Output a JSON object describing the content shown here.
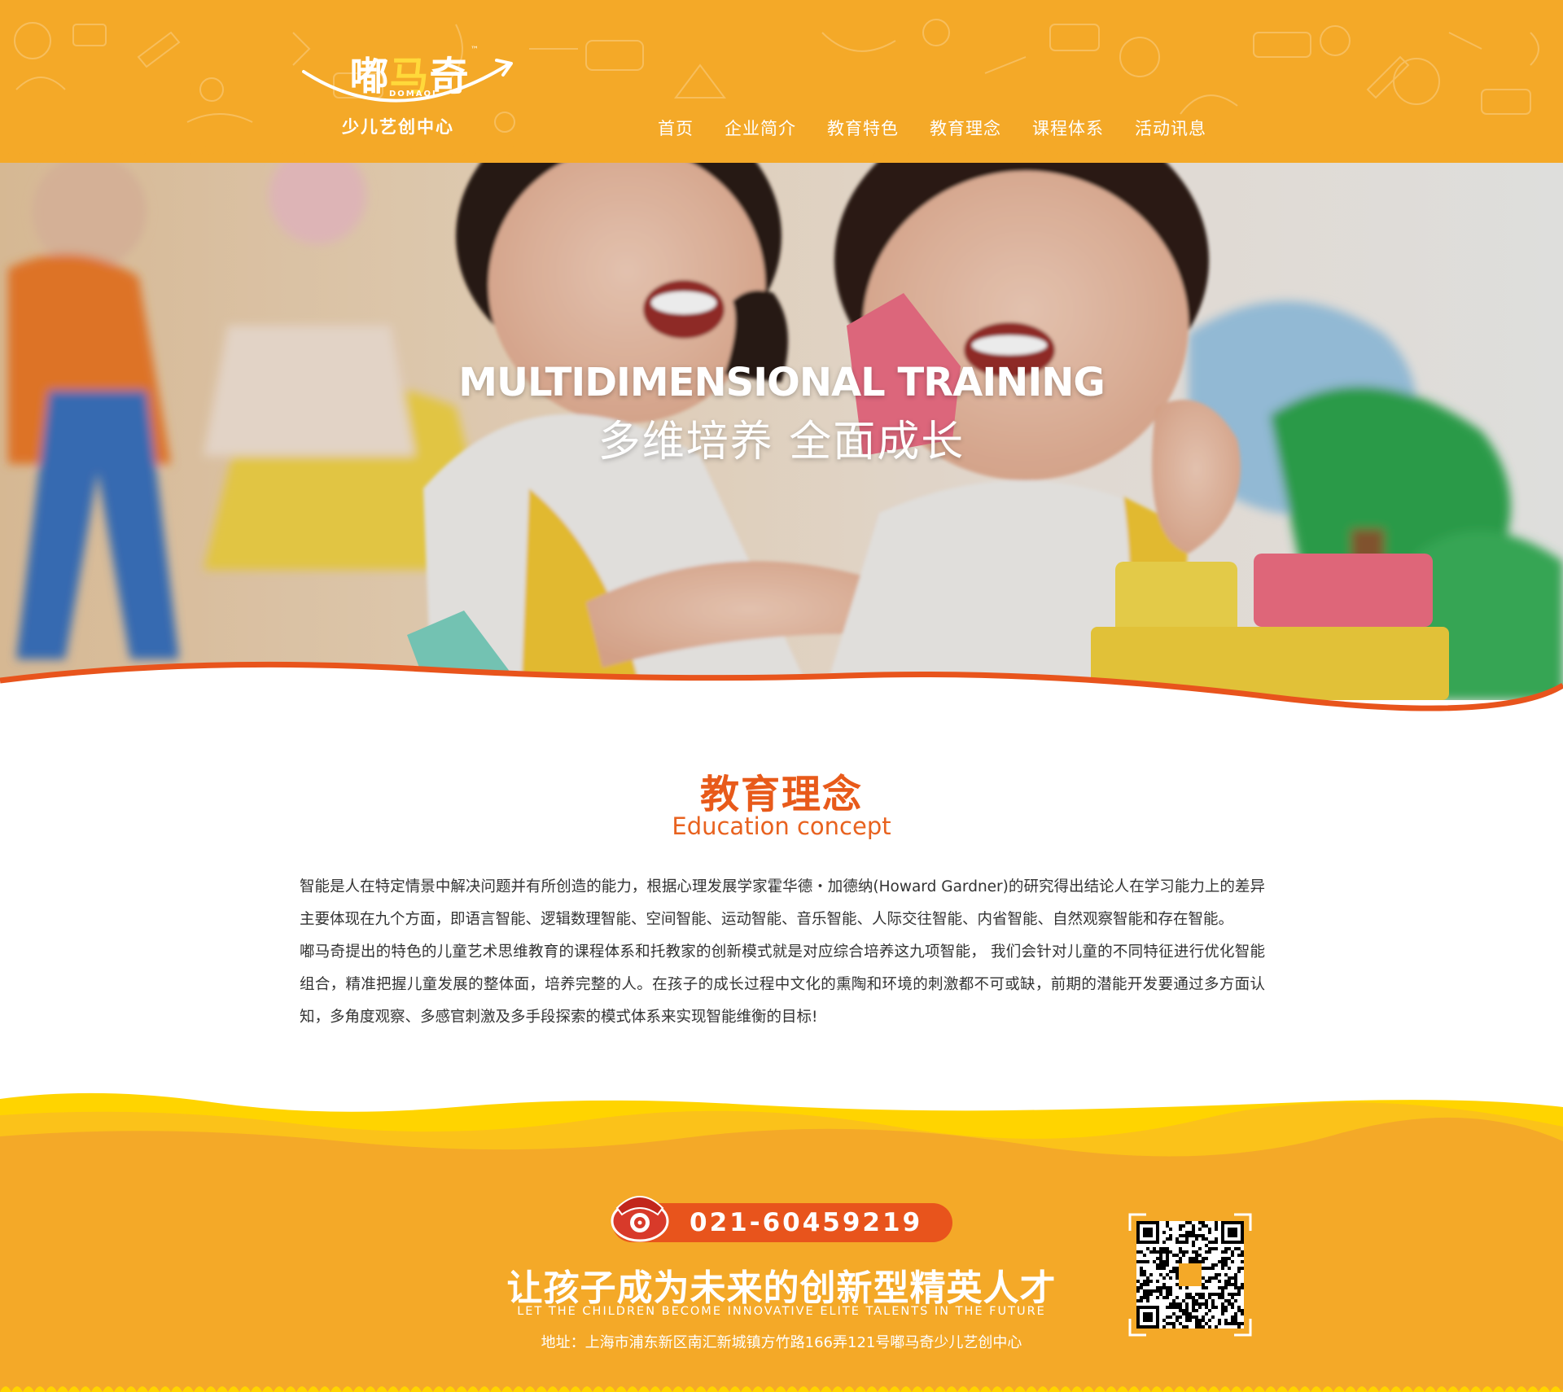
{
  "brand": {
    "name_part1": "嘟",
    "name_part2": "马",
    "name_part3": "奇",
    "trademark": "™",
    "name_en": "DOMAQI",
    "subtitle": "少儿艺创中心"
  },
  "nav": {
    "items": [
      {
        "label": "首页"
      },
      {
        "label": "企业简介"
      },
      {
        "label": "教育特色"
      },
      {
        "label": "教育理念"
      },
      {
        "label": "课程体系"
      },
      {
        "label": "活动讯息"
      }
    ]
  },
  "hero": {
    "title": "MULTIDIMENSIONAL TRAINING",
    "subtitle": "多维培养 全面成长"
  },
  "section": {
    "title": "教育理念",
    "subtitle": "Education concept",
    "paragraphs": [
      "智能是人在特定情景中解决问题并有所创造的能力，根据心理发展学家霍华德・加德纳(Howard Gardner)的研究得出结论人在学习能力上的差异主要体现在九个方面，即语言智能、逻辑数理智能、空间智能、运动智能、音乐智能、人际交往智能、内省智能、自然观察智能和存在智能。",
      "嘟马奇提出的特色的儿童艺术思维教育的课程体系和托教家的创新模式就是对应综合培养这九项智能， 我们会针对儿童的不同特征进行优化智能组合，精准把握儿童发展的整体面，培养完整的人。在孩子的成长过程中文化的熏陶和环境的刺激都不可或缺，前期的潜能开发要通过多方面认知，多角度观察、多感官刺激及多手段探索的模式体系来实现智能维衡的目标!"
    ]
  },
  "footer": {
    "phone": "021-60459219",
    "slogan": "让孩子成为未来的创新型精英人才",
    "slogan_en": "LET THE CHILDREN BECOME INNOVATIVE ELITE TALENTS IN THE FUTURE",
    "address": "地址：上海市浦东新区南汇新城镇方竹路166弄121号嘟马奇少儿艺创中心"
  },
  "colors": {
    "header_bg": "#f4a928",
    "accent_orange": "#e85a1a",
    "footer_bg": "#f4a928",
    "wave_yellow": "#ffd400",
    "text_body": "#333333"
  },
  "icons": {
    "phone": "telephone-icon",
    "qr": "qr-code-icon"
  }
}
